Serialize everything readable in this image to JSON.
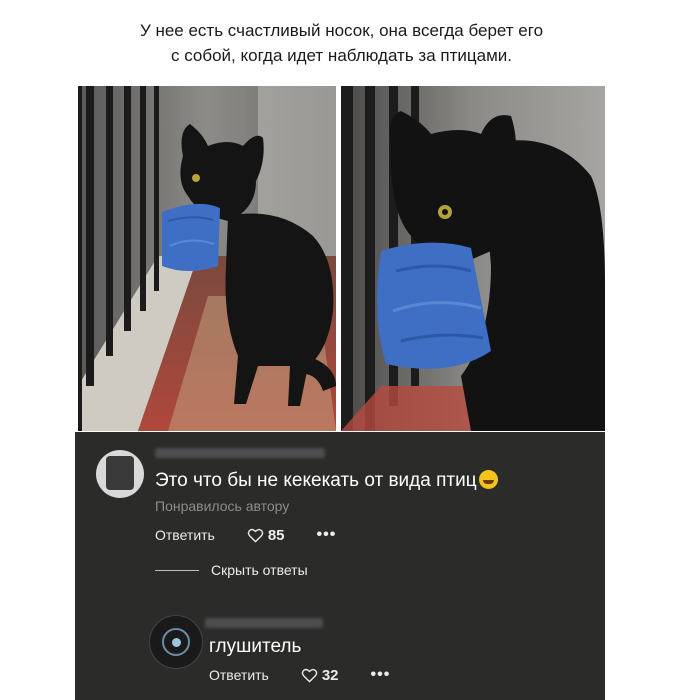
{
  "post": {
    "caption_line1": "У нее есть счастливый носок, она всегда берет его",
    "caption_line2": "с собой, когда идет наблюдать за птицами."
  },
  "comments": [
    {
      "text": "Это что бы не кекекать от вида птиц",
      "emoji": "sweat-smile-emoji",
      "liked_by_author": "Понравилось автору",
      "reply_label": "Ответить",
      "likes": "85",
      "more": "•••"
    }
  ],
  "replies_toggle": {
    "label": "Скрыть ответы"
  },
  "replies": [
    {
      "text": "глушитель",
      "reply_label": "Ответить",
      "likes": "32",
      "more": "•••"
    }
  ],
  "colors": {
    "comments_bg": "#2b2b29",
    "sock_blue": "#3f6fc4",
    "cat_black": "#141414"
  }
}
